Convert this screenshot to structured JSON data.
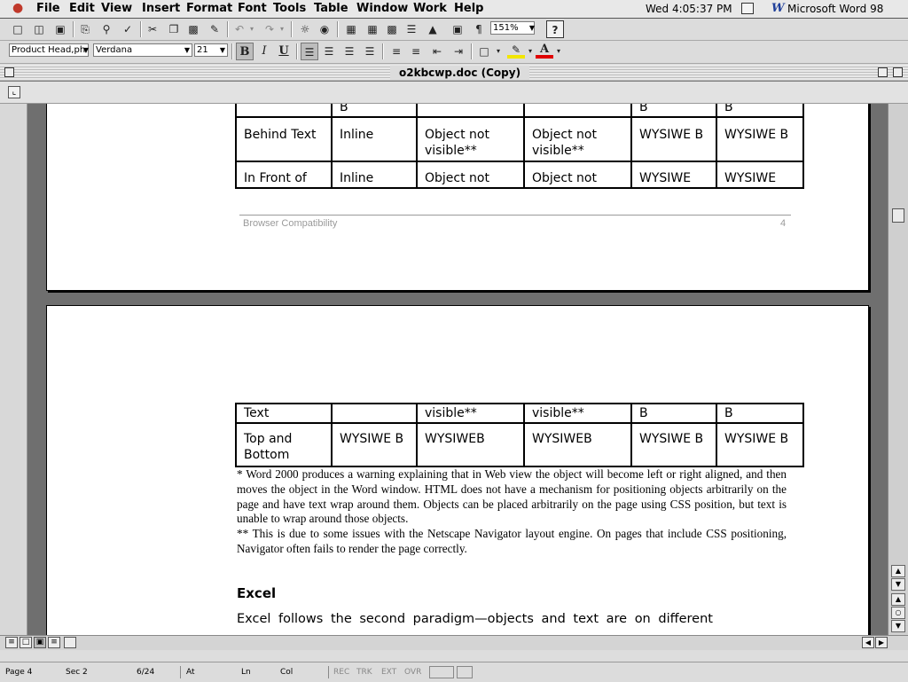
{
  "menubar": {
    "items": [
      "File",
      "Edit",
      "View",
      "Insert",
      "Format",
      "Font",
      "Tools",
      "Table",
      "Window",
      "Work",
      "Help"
    ],
    "clock": "Wed 4:05:37 PM",
    "app_name": "Microsoft Word 98"
  },
  "format_toolbar": {
    "style_value": "Product Head,ph",
    "font_value": "Verdana",
    "size_value": "21",
    "bold_label": "B",
    "italic_label": "I",
    "underline_label": "U",
    "font_color_label": "A"
  },
  "standard_toolbar": {
    "zoom_value": "151%",
    "pilcrow_label": "¶",
    "help_label": "?"
  },
  "window": {
    "title": "o2kbcwp.doc (Copy)"
  },
  "page1": {
    "table_rows": [
      [
        "",
        "B",
        "",
        "",
        "B",
        "B"
      ],
      [
        "Behind Text",
        "Inline",
        "Object not visible**",
        "Object not visible**",
        "WYSIWE B",
        "WYSIWE B"
      ],
      [
        "In Front of",
        "Inline",
        "Object not",
        "Object not",
        "WYSIWE",
        "WYSIWE"
      ]
    ],
    "footer_left": "Browser Compatibility",
    "footer_right": "4"
  },
  "page2": {
    "table_rows": [
      [
        "Text",
        "",
        "visible**",
        "visible**",
        "B",
        "B"
      ],
      [
        "Top and Bottom",
        "WYSIWE B",
        "WYSIWEB",
        "WYSIWEB",
        "WYSIWE B",
        "WYSIWE B"
      ]
    ],
    "note1": "* Word 2000 produces a warning explaining that in Web view the object will become left or right aligned, and then moves the object in the Word window. HTML does not have a mechanism for positioning objects arbitrarily on the page and have text wrap around them. Objects can be placed arbitrarily on the page using CSS position, but text is unable to wrap around those objects.",
    "note2": "** This is due to some issues with the Netscape Navigator layout engine. On pages that include CSS positioning, Navigator often fails to render the page correctly.",
    "heading": "Excel",
    "body_text": "Excel follows the second paradigm—objects and text are on different"
  },
  "status": {
    "page": "Page 4",
    "sec": "Sec 2",
    "pages": "6/24",
    "at": "At",
    "ln": "Ln",
    "col": "Col",
    "rec": "REC",
    "trk": "TRK",
    "ext": "EXT",
    "ovr": "OVR"
  }
}
